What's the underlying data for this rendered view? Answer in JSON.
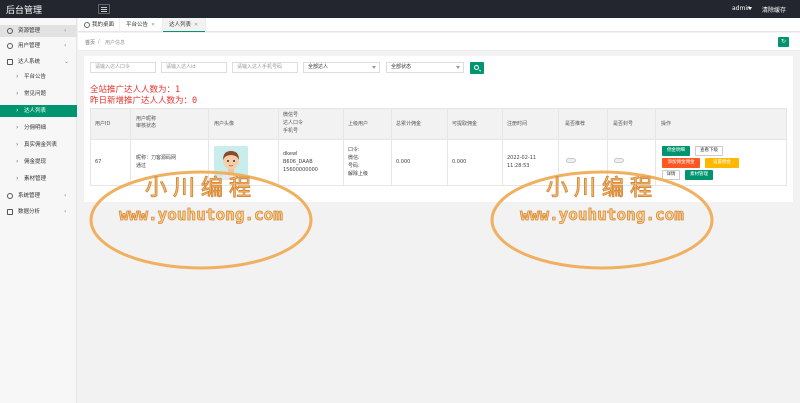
{
  "app": {
    "title": "后台管理",
    "user": "admin",
    "clear_cache": "清除缓存"
  },
  "sidebar": {
    "items": [
      {
        "label": "资源管理",
        "icon": "user-icon"
      },
      {
        "label": "用户管理",
        "icon": "settings-icon"
      },
      {
        "label": "达人系统",
        "icon": "people-icon"
      },
      {
        "label": "平台公告"
      },
      {
        "label": "常见问题"
      },
      {
        "label": "达人列表"
      },
      {
        "label": "分佣明细"
      },
      {
        "label": "真实佣金列表"
      },
      {
        "label": "佣金提现"
      },
      {
        "label": "素材管理"
      },
      {
        "label": "系统管理",
        "icon": "gear-icon"
      },
      {
        "label": "数据分析",
        "icon": "chart-icon"
      }
    ]
  },
  "tabs": [
    {
      "label": "我的桌面"
    },
    {
      "label": "平台公告"
    },
    {
      "label": "达人列表"
    }
  ],
  "breadcrumb": {
    "home": "首页",
    "current": "用户信息"
  },
  "filters": {
    "code_placeholder": "请输入达人口令",
    "id_placeholder": "请输入达人id",
    "phone_placeholder": "请输入达人手机号码",
    "level_select": "全部达人",
    "status_select": "全部状态"
  },
  "stats": {
    "total": "全站推广达人人数为：1",
    "yesterday": "昨日新增推广达人人数为：0"
  },
  "table": {
    "headers": {
      "user_id": "用户ID",
      "nickname": "用户昵称",
      "review": "审核状态",
      "avatar": "用户头像",
      "wechat": "微信号",
      "code": "达人口令",
      "phone": "手机号",
      "parent": "上级用户",
      "total_commission": "总累计佣金",
      "withdrawable": "可提取佣金",
      "reg_time": "注册时间",
      "recommend": "是否推荐",
      "banned": "是否封号",
      "actions": "操作"
    },
    "row": {
      "user_id": "67",
      "nickname": "昵称：刀客源码网",
      "remark": "通过",
      "wechat": "dkewl",
      "code": "B606_DAAB",
      "phone": "15600000000",
      "parent_code": "口令:",
      "parent_wechat": "微信:",
      "parent_phone": "号码:",
      "parent_unbind": "解除上级",
      "total_commission": "0.000",
      "withdrawable": "0.000",
      "reg_date": "2022-02-11",
      "reg_clock": "11:28:53"
    },
    "actions": {
      "commission_detail": "佣金明细",
      "view_sub": "查看下级",
      "add_commission": "添加佣金佣金",
      "set_commission": "设置佣金",
      "detail": "详情",
      "material": "素材管理"
    }
  },
  "watermark": {
    "title": "小川编程",
    "url": "www.youhutong.com"
  },
  "colors": {
    "accent": "#00956f",
    "topbar": "#23262e",
    "stat": "#e4332e",
    "orange": "#ff5722",
    "yellow": "#ffb800",
    "watermark": "#f0b060"
  }
}
